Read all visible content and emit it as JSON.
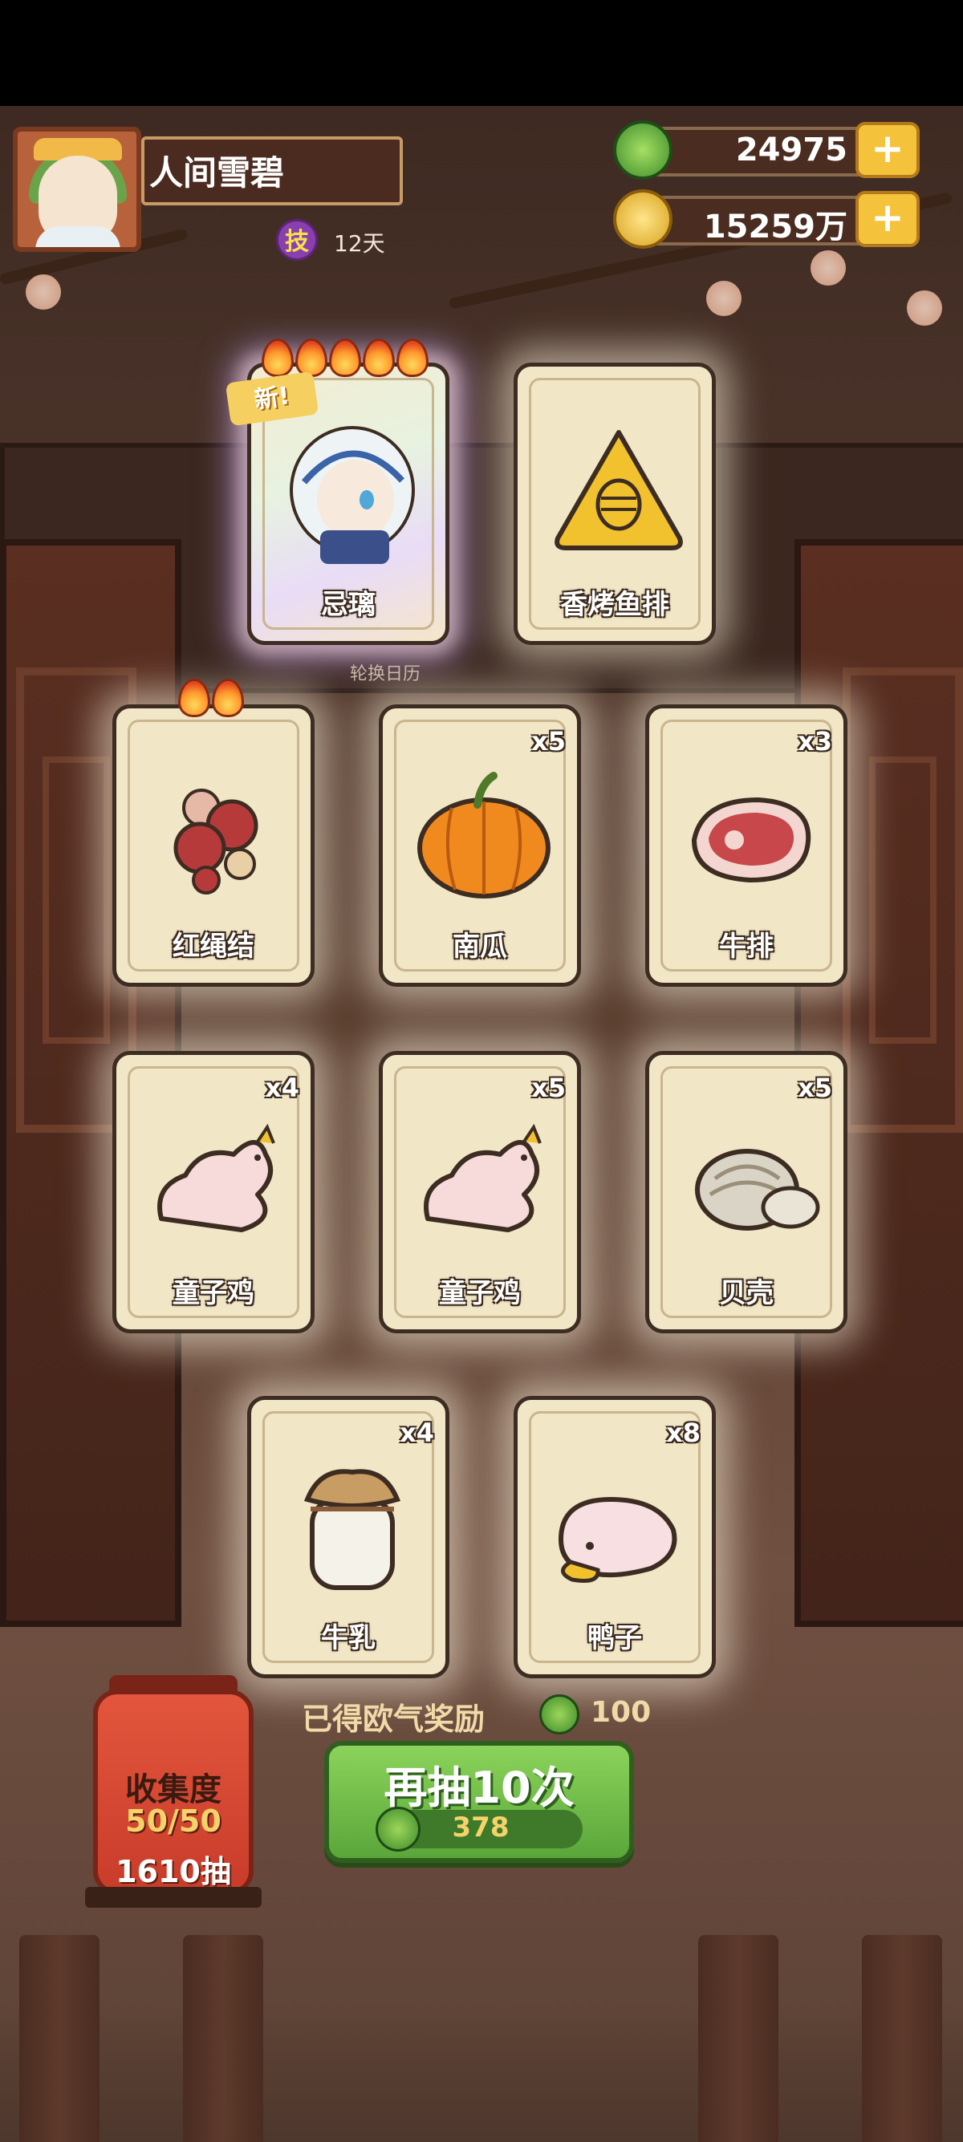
{
  "profile": {
    "player_name": "人间雪碧",
    "buff_icon_glyph": "技",
    "buff_days": "12天"
  },
  "currency": {
    "jade": "24975",
    "coins": "15259万",
    "plus_glyph": "+"
  },
  "cards": [
    {
      "label": "忌璃",
      "qty": "",
      "icon": "character-portrait",
      "flames": 5,
      "new": true,
      "rainbow": true
    },
    {
      "label": "香烤鱼排",
      "qty": "",
      "icon": "fish-fillet-icon",
      "flames": 0
    },
    {
      "label": "红绳结",
      "qty": "",
      "icon": "red-knot-icon",
      "flames": 2
    },
    {
      "label": "南瓜",
      "qty": "x5",
      "icon": "pumpkin-icon",
      "flames": 0
    },
    {
      "label": "牛排",
      "qty": "x3",
      "icon": "steak-icon",
      "flames": 0
    },
    {
      "label": "童子鸡",
      "qty": "x4",
      "icon": "chicken-icon",
      "flames": 0
    },
    {
      "label": "童子鸡",
      "qty": "x5",
      "icon": "chicken-icon",
      "flames": 0
    },
    {
      "label": "贝壳",
      "qty": "x5",
      "icon": "clam-icon",
      "flames": 0
    },
    {
      "label": "牛乳",
      "qty": "x4",
      "icon": "milk-jar-icon",
      "flames": 0
    },
    {
      "label": "鸭子",
      "qty": "x8",
      "icon": "duck-icon",
      "flames": 0
    }
  ],
  "new_badge": "新!",
  "sub_caption": "轮换日历",
  "collection": {
    "title": "收集度",
    "count": "50/50",
    "pulls": "1610抽"
  },
  "reward": {
    "label": "已得欧气奖励",
    "value": "100"
  },
  "draw_button": {
    "label": "再抽10次",
    "cost": "378"
  },
  "colors": {
    "accent_green": "#5aa63a",
    "gold": "#f5c23b",
    "card_bg": "#f1e6c6",
    "wood": "#3e2a22"
  }
}
